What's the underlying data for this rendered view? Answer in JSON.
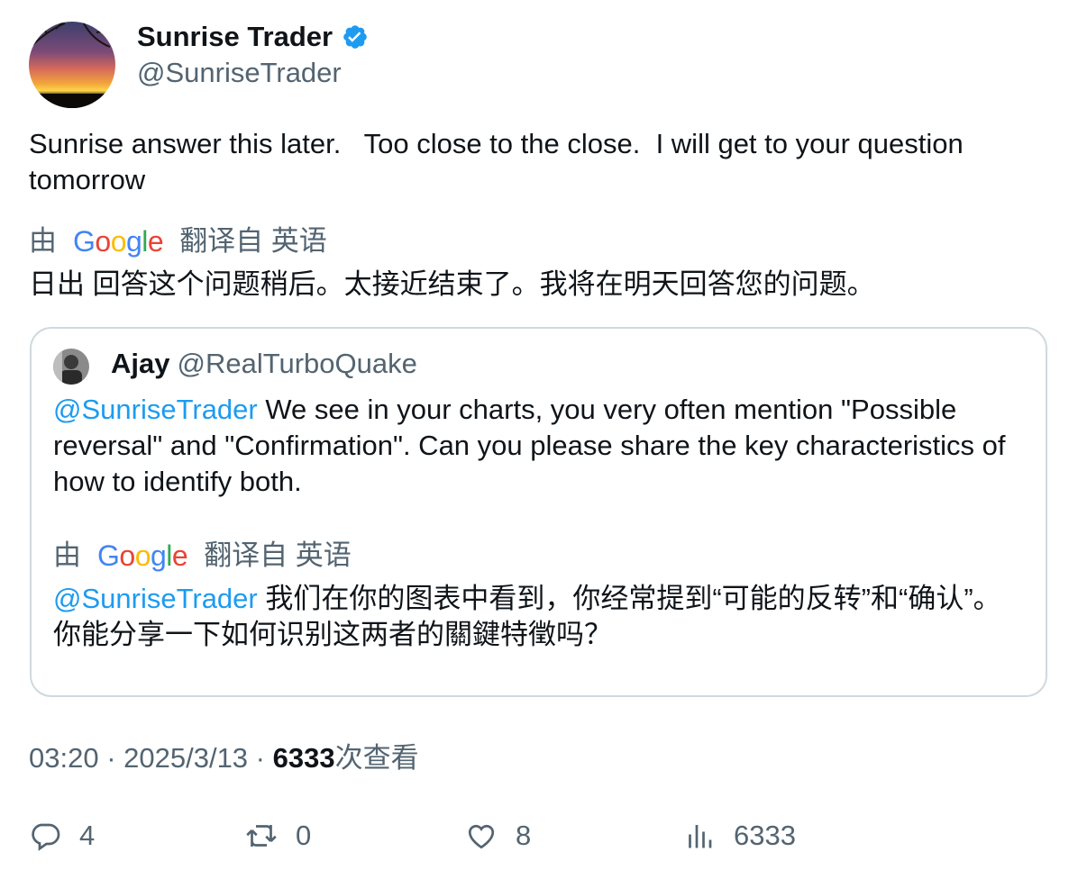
{
  "author": {
    "display_name": "Sunrise Trader",
    "handle": "@SunriseTrader",
    "verified_icon": "verified-badge-icon"
  },
  "tweet": {
    "text": "Sunrise answer this later.   Too close to the close.  I will get to your question tomorrow",
    "translation": {
      "prefix": "由",
      "provider": "Google",
      "suffix": "翻译自 英语",
      "text": "日出 回答这个问题稍后。太接近结束了。我将在明天回答您的问题。"
    }
  },
  "quoted_tweet": {
    "display_name": "Ajay",
    "handle": "@RealTurboQuake",
    "mention": "@SunriseTrader",
    "text": " We see in your charts, you very often mention \"Possible reversal\" and \"Confirmation\". Can you please share the key characteristics of how to identify both.",
    "translation": {
      "prefix": "由",
      "provider": "Google",
      "suffix": "翻译自 英语",
      "mention": "@SunriseTrader",
      "text": " 我们在你的图表中看到，你经常提到“可能的反转”和“确认”。你能分享一下如何识别这两者的關鍵特徵吗？"
    }
  },
  "meta": {
    "time": "03:20",
    "sep1": " · ",
    "date": "2025/3/13",
    "sep2": " · ",
    "views_count": "6333",
    "views_label": "次查看"
  },
  "actions": {
    "replies": "4",
    "retweets": "0",
    "likes": "8",
    "views": "6333"
  },
  "colors": {
    "accent": "#1d9bf0",
    "secondary_text": "#536471",
    "border": "#cfd9de"
  }
}
